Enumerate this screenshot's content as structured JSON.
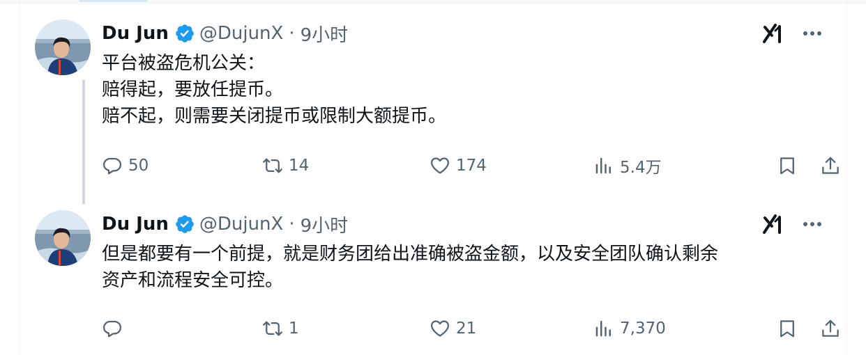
{
  "tweets": [
    {
      "author": {
        "name": "Du Jun",
        "handle": "@DujunX",
        "separator": "·",
        "time": "9小时",
        "verified": true
      },
      "text_lines": [
        "平台被盗危机公关：",
        "赔得起，要放任提币。",
        "赔不起，则需要关闭提币或限制大额提币。"
      ],
      "stats": {
        "replies": "50",
        "reposts": "14",
        "likes": "174",
        "views": "5.4万"
      }
    },
    {
      "author": {
        "name": "Du Jun",
        "handle": "@DujunX",
        "separator": "·",
        "time": "9小时",
        "verified": true
      },
      "text_lines": [
        "但是都要有一个前提，就是财务团给出准确被盗金额，以及安全团队确认剩余",
        "资产和流程安全可控。"
      ],
      "stats": {
        "replies": "",
        "reposts": "1",
        "likes": "21",
        "views": "7,370"
      }
    }
  ],
  "icons": [
    "verified-badge-icon",
    "grok-icon",
    "more-icon",
    "reply-icon",
    "repost-icon",
    "like-icon",
    "views-icon",
    "bookmark-icon",
    "share-icon"
  ],
  "colors": {
    "verified": "#1d9bf0",
    "text": "#0f1419",
    "secondary": "#536471",
    "thread_line": "#cfd9de"
  }
}
